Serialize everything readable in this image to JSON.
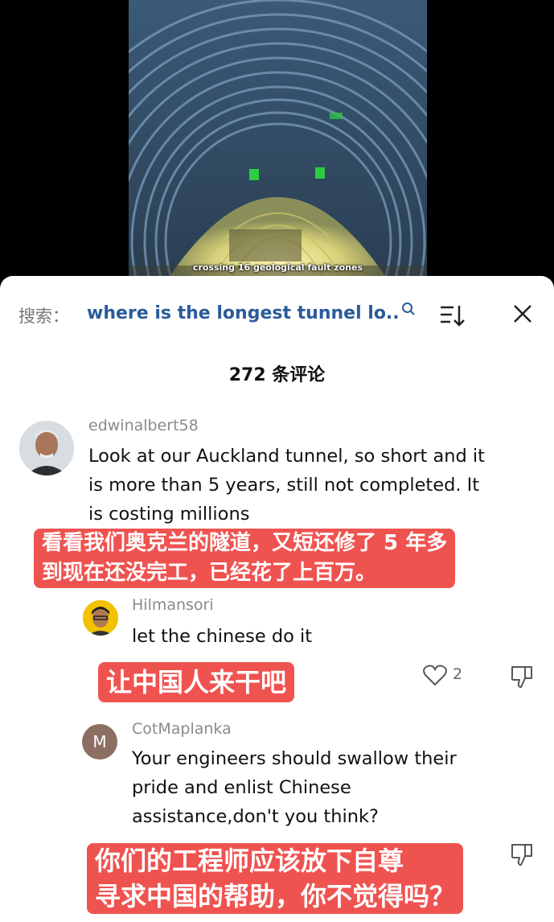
{
  "video": {
    "caption": "crossing 16 geological fault zones"
  },
  "search": {
    "label": "搜索：",
    "query": "where is the longest tunnel lo..."
  },
  "comments_header": {
    "count_text": "272 条评论"
  },
  "comments": [
    {
      "username": "edwinalbert58",
      "text_lines": [
        "Look at our Auckland tunnel, so short and it",
        "is more than 5 years, still not completed. It",
        "is costing millions"
      ],
      "translation_lines": [
        "看看我们奥克兰的隧道，又短还修了 5 年多",
        "到现在还没完工，已经花了上百万。"
      ]
    },
    {
      "username": "Hilmansori",
      "text_lines": [
        "let the chinese do it"
      ],
      "translation_lines": [
        "让中国人来干吧"
      ],
      "likes": "2"
    },
    {
      "username": "CotMaplanka",
      "avatar_letter": "M",
      "text_lines": [
        "Your engineers should swallow their",
        "pride and enlist Chinese",
        "assistance,don't you think?"
      ],
      "translation_lines": [
        "你们的工程师应该放下自尊",
        "寻求中国的帮助，你不觉得吗？"
      ]
    }
  ],
  "colors": {
    "search_query": "#2b5b9b",
    "translation_bg": "#ef5350",
    "username": "#8a8a8a"
  },
  "icons": [
    "search-icon",
    "sort-icon",
    "close-icon",
    "heart-icon",
    "dislike-icon"
  ]
}
